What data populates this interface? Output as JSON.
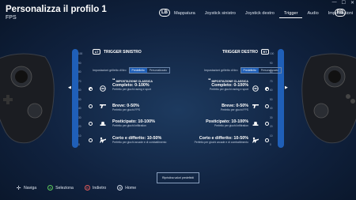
{
  "header": {
    "title": "Personalizza il profilo 1",
    "subtitle": "FPS",
    "bumper_left": "LB",
    "bumper_right": "RB"
  },
  "tabs": [
    {
      "label": "Mappatura"
    },
    {
      "label": "Joystick sinistro"
    },
    {
      "label": "Joystick destro"
    },
    {
      "label": "Trigger",
      "active": true
    },
    {
      "label": "Audio"
    },
    {
      "label": "Impostazioni"
    }
  ],
  "scale_ticks": [
    "100",
    "90",
    "80",
    "70",
    "60",
    "50",
    "40",
    "30",
    "20",
    "10",
    "0"
  ],
  "left_panel": {
    "icon": "LT",
    "title": "TRIGGER SINISTRO",
    "setting_label": "Impostazioni grilletto di tiro",
    "seg_on": "Predefinito",
    "seg_off": "Personalizzato"
  },
  "right_panel": {
    "icon": "RT",
    "title": "TRIGGER DESTRO",
    "setting_label": "Impostazioni grilletto di tiro",
    "seg_on": "Predefinito",
    "seg_off": "Personalizzato"
  },
  "options": [
    {
      "pre": "IMPOSTAZIONE CLASSICA",
      "title": "Completo: 0-100%",
      "desc": "Perfetto per giochi racing e sport",
      "icon": "steering-wheel-icon",
      "selected": true
    },
    {
      "pre": "",
      "title": "Breve: 0-50%",
      "desc": "Perfetto per giochi FPS",
      "icon": "pistol-icon",
      "selected": false
    },
    {
      "pre": "",
      "title": "Posticipato: 10-100%",
      "desc": "Perfetto per giochi infiltration",
      "icon": "hat-icon",
      "selected": false
    },
    {
      "pre": "",
      "title": "Corto e differito: 10-50%",
      "desc": "Perfetto per giochi arcade e di combattimento",
      "icon": "fighter-icon",
      "selected": false
    }
  ],
  "reset_button": "Ripristina valori predefiniti",
  "footer": [
    {
      "icon": "dpad-icon",
      "glyph": "✛",
      "label": "Naviga",
      "color": "#cfd8e6"
    },
    {
      "icon": "a-button-icon",
      "glyph": "A",
      "label": "Seleziona",
      "color": "#5cc85c"
    },
    {
      "icon": "b-button-icon",
      "glyph": "B",
      "label": "Indietro",
      "color": "#e05a5a"
    },
    {
      "icon": "xbox-icon",
      "glyph": "⊛",
      "label": "Home",
      "color": "#cfd8e6"
    }
  ],
  "colors": {
    "accent": "#1f5fb8",
    "background": "#10223f"
  }
}
